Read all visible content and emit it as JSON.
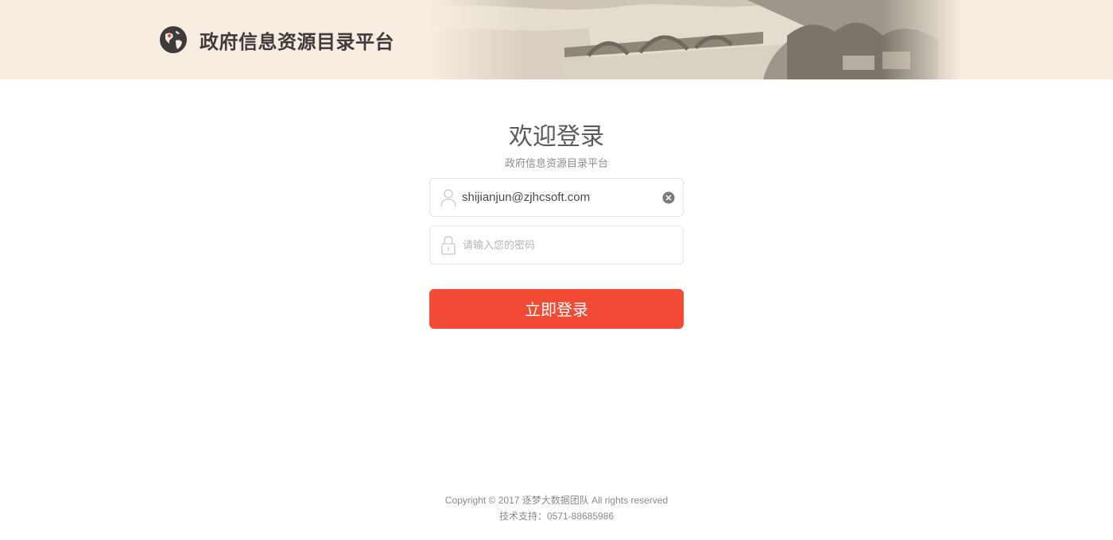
{
  "header": {
    "title": "政府信息资源目录平台",
    "logo_icon": "globe-icon",
    "background_color": "#f7ede1",
    "banner_image": "stone-arch-bridge-landscape"
  },
  "login": {
    "welcome": "欢迎登录",
    "subtitle": "政府信息资源目录平台",
    "username": {
      "value": "shijianjun@zjhcsoft.com",
      "icon": "user-icon",
      "clear_icon": "clear-icon"
    },
    "password": {
      "placeholder": "请输入您的密码",
      "icon": "lock-icon"
    },
    "submit_label": "立即登录",
    "submit_color": "#f34a35"
  },
  "footer": {
    "copyright": "Copyright © 2017 逐梦大数据团队  All rights reserved",
    "support": "技术支持：0571-88685986"
  }
}
